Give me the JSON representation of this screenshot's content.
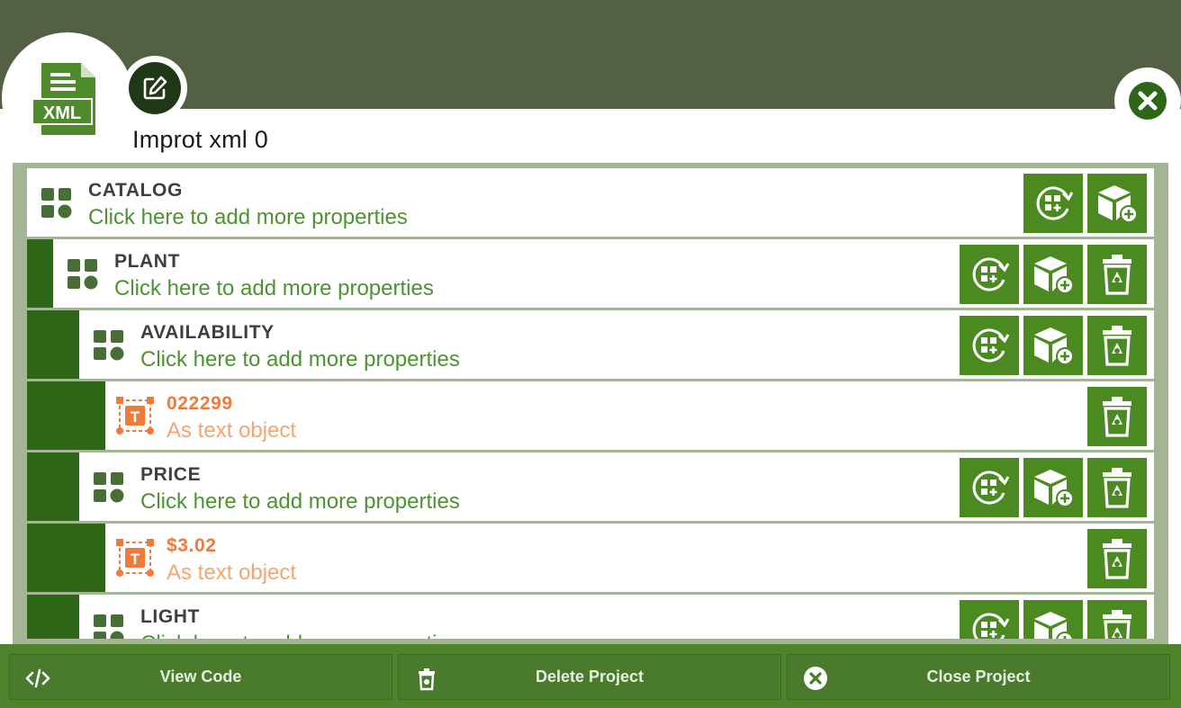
{
  "project": {
    "title": "Improt xml 0"
  },
  "tree": {
    "rows": [
      {
        "name": "CATALOG",
        "subtitle": "Click here to add more properties",
        "kind": "group",
        "icon": "grid-shapes-icon",
        "actions": [
          "switch-icon",
          "add-cube-icon"
        ]
      },
      {
        "name": "PLANT",
        "subtitle": "Click here to add more properties",
        "kind": "group",
        "icon": "grid-shapes-icon",
        "actions": [
          "switch-icon",
          "add-cube-icon",
          "trash-icon"
        ]
      },
      {
        "name": "AVAILABILITY",
        "subtitle": "Click here to add more properties",
        "kind": "group",
        "icon": "grid-shapes-icon",
        "actions": [
          "switch-icon",
          "add-cube-icon",
          "trash-icon"
        ]
      },
      {
        "name": "022299",
        "subtitle": "As text object",
        "kind": "text-object",
        "icon": "text-frame-icon",
        "actions": [
          "trash-icon"
        ]
      },
      {
        "name": "PRICE",
        "subtitle": "Click here to add more properties",
        "kind": "group",
        "icon": "grid-shapes-icon",
        "actions": [
          "switch-icon",
          "add-cube-icon",
          "trash-icon"
        ]
      },
      {
        "name": "$3.02",
        "subtitle": "As text object",
        "kind": "text-object",
        "icon": "text-frame-icon",
        "actions": [
          "trash-icon"
        ]
      },
      {
        "name": "LIGHT",
        "subtitle": "Click here to add more properties",
        "kind": "group",
        "icon": "grid-shapes-icon",
        "actions": [
          "switch-icon",
          "add-cube-icon",
          "trash-icon"
        ]
      }
    ]
  },
  "footer": {
    "view_code": "View Code",
    "delete_project": "Delete Project",
    "close_project": "Close Project"
  },
  "colors": {
    "header_band": "#536044",
    "accent_green": "#4a8a20",
    "indent_green": "#2e6618",
    "subtitle_green": "#4d9431",
    "object_orange": "#f07a3a"
  }
}
